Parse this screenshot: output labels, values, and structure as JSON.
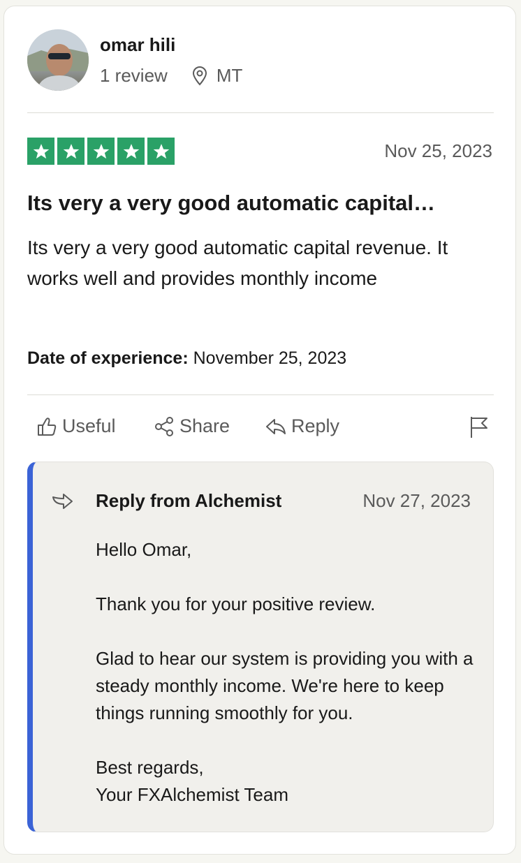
{
  "reviewer": {
    "name": "omar hili",
    "review_count": "1 review",
    "country": "MT"
  },
  "review": {
    "rating": 5,
    "rating_color": "#2aa167",
    "date": "Nov 25, 2023",
    "title": "Its very a very good automatic capital…",
    "body": "Its very a very good automatic capital revenue. It works well and provides monthly income",
    "experience_label": "Date of experience:",
    "experience_date": "November 25, 2023"
  },
  "actions": {
    "useful": "Useful",
    "share": "Share",
    "reply": "Reply"
  },
  "company_reply": {
    "accent_color": "#3b63d6",
    "from": "Reply from Alchemist",
    "date": "Nov 27, 2023",
    "paragraphs": [
      "Hello Omar,",
      "Thank you for your positive review.",
      "Glad to hear our system is providing you with a steady monthly income. We're here to keep things running smoothly for you.",
      "Best regards,",
      "Your FXAlchemist Team"
    ]
  },
  "icons": [
    "map-pin-icon",
    "star-icon",
    "thumbs-up-icon",
    "share-icon",
    "reply-icon",
    "flag-icon",
    "reply-arrow-icon"
  ]
}
